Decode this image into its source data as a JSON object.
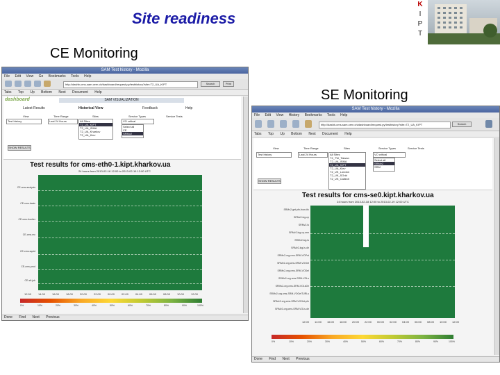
{
  "slide": {
    "title": "Site readiness",
    "logo_letters": [
      "K",
      "I",
      "P",
      "T"
    ],
    "ce_heading": "CE Monitoring",
    "se_heading": "SE Monitoring"
  },
  "colors": {
    "title": "#1a1aa6",
    "good": "#1e7a3d",
    "bad": "#c62828"
  },
  "ce_window": {
    "title": "SAM Test history - Mozilla",
    "menu": [
      "File",
      "Edit",
      "View",
      "Go",
      "Bookmarks",
      "Tools",
      "Help"
    ],
    "nav": [
      "Back",
      "Forward",
      "Reload",
      "Stop"
    ],
    "url": "http://dashb-cms-sam.cern.ch/dashboard/request.py/testhistory?site=T2_UA_KIPT",
    "search_label": "Search",
    "print_label": "Print",
    "bookmarks": [
      "Tabs",
      "Top",
      "Up",
      "Bottom",
      "Next",
      "Document",
      "Help"
    ],
    "dash_logo": "dashboard",
    "dash_head": "SAM VISUALIZATION",
    "tabs": [
      "Latest Results",
      "Historical View",
      "Feedback",
      "Help"
    ],
    "view_label": "View",
    "view_value": "Test history",
    "time_label": "Time Range",
    "time_value": "Last 24 Hours",
    "sites_label": "Sites",
    "sites": [
      "All Sites",
      "T2_UA_KIPT",
      "T2_UA_ISMA",
      "T2_UA_Kharkov",
      "T2_UA_Kiev"
    ],
    "sites_selected": 1,
    "service_label": "Service Types",
    "service_value": "VO critical",
    "tests_label": "Service Tests",
    "tests": [
      "Select all",
      "CE",
      "SRMv2"
    ],
    "show_button": "SHOW RESULTS",
    "chart_title": "Test results for cms-eth0-1.kipt.kharkov.ua",
    "chart_sub": "24 hours from 2013-02-18 12:00 to 2013-02-19 12:00 UTC",
    "row_labels": [
      "CE-cms-analysis",
      "CE-cms-basic",
      "CE-cms-frontier",
      "CE-cms-mc",
      "CE-cms-squid",
      "CE-cms-prod",
      "CE-sft-job"
    ],
    "x_ticks": [
      "12:00",
      "14:00",
      "16:00",
      "18:00",
      "20:00",
      "22:00",
      "00:00",
      "02:00",
      "04:00",
      "06:00",
      "08:00",
      "10:00",
      "12:00"
    ],
    "cb_ticks": [
      "0%",
      "10%",
      "20%",
      "30%",
      "40%",
      "50%",
      "60%",
      "70%",
      "80%",
      "90%",
      "100%"
    ],
    "status": [
      "Done",
      "Find",
      "Next",
      "Previous"
    ]
  },
  "se_window": {
    "title": "SAM Test history - Mozilla",
    "menu": [
      "File",
      "Edit",
      "View",
      "History",
      "Bookmarks",
      "Tools",
      "Help"
    ],
    "nav": [
      "Back",
      "Forward",
      "Reload",
      "Stop",
      "Home"
    ],
    "url": "http://dashb-cms-sam.cern.ch/dashboard/request.py/testhistory?site=T2_UA_KIPT",
    "search_label": "Search",
    "bookmarks": [
      "Tabs",
      "Top",
      "Up",
      "Bottom",
      "Next",
      "Document",
      "Help"
    ],
    "view_label": "View",
    "view_value": "Test history",
    "time_label": "Time Range",
    "time_value": "Last 24 Hours",
    "sites_label": "Sites",
    "sites": [
      "All Sites",
      "T2_TW_Taiwan",
      "T2_UA_ISMA",
      "T2_UA_KIPT",
      "T2_UA_Kiev",
      "T2_UK_London",
      "T2_UK_SGrid",
      "T2_US_Caltech"
    ],
    "sites_selected": 3,
    "service_label": "Service Types",
    "service_value": "VO critical",
    "tests_label": "Service Tests",
    "tests": [
      "Select all",
      "SRMv2",
      "SRM"
    ],
    "show_button": "SHOW RESULTS",
    "chart_title": "Test results for cms-se0.kipt.kharkov.ua",
    "chart_sub": "24 hours from 2013-02-18 12:00 to 2013-02-19 12:00 UTC",
    "row_labels": [
      "SRMv2-get-pfn-from-tfc",
      "SRMv2-lcg-cp",
      "SRMv2-ls",
      "SRMv2-lcg-cp-srm",
      "SRMv2-lcg-ls",
      "SRMv2-lcg-ls-dir",
      "SRMv2-org.cms-SRM-VOPut",
      "SRMv2-org.cms-SRM-VOGet",
      "SRMv2-org.cms-SRM-VODel",
      "SRMv2-org.cms-SRM-VOLs",
      "SRMv2-org.cms-SRM-VOLsDir",
      "SRMv2-org.cms-SRM-VOGetTURLs",
      "SRMv2-org.cms-SRM-VOGet-pfn",
      "SRMv2-org.cms-SRM-VOLs-dir"
    ],
    "x_ticks": [
      "12:00",
      "14:00",
      "16:00",
      "18:00",
      "20:00",
      "22:00",
      "00:00",
      "02:00",
      "04:00",
      "06:00",
      "08:00",
      "10:00",
      "12:00"
    ],
    "cb_ticks": [
      "0%",
      "10%",
      "20%",
      "30%",
      "40%",
      "50%",
      "60%",
      "70%",
      "80%",
      "90%",
      "100%"
    ],
    "status": [
      "Done",
      "Find",
      "Next",
      "Previous"
    ]
  }
}
